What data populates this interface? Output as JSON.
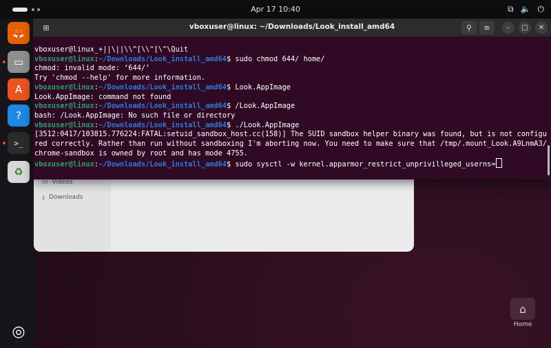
{
  "topbar": {
    "clock": "Apr 17  10:40",
    "tray_icons": [
      "network-icon",
      "volume-icon",
      "power-icon"
    ]
  },
  "dock": {
    "items": [
      {
        "name": "firefox-icon",
        "glyph": "🦊",
        "bg": "#e66000",
        "running": false
      },
      {
        "name": "files-icon",
        "glyph": "▭",
        "bg": "#8f8f8f",
        "running": true
      },
      {
        "name": "app-center-icon",
        "glyph": "A",
        "bg": "#e95420",
        "running": false
      },
      {
        "name": "help-icon",
        "glyph": "?",
        "bg": "#1e88e5",
        "running": false
      },
      {
        "name": "terminal-icon",
        "glyph": ">_",
        "bg": "#2b2b2b",
        "running": true
      },
      {
        "name": "trash-icon",
        "glyph": "♻",
        "bg": "#d8d8d8",
        "running": false
      }
    ],
    "show_apps_glyph": "◎"
  },
  "files_window": {
    "items": [
      "Videos",
      "Downloads"
    ]
  },
  "terminal": {
    "title": "vboxuser@linux: ~/Downloads/Look_install_amd64",
    "prompt_user": "vboxuser@linux",
    "prompt_sep": ":",
    "prompt_path": "~/Downloads/Look_install_amd64",
    "prompt_end": "$ ",
    "lines": [
      {
        "type": "out",
        "text": "vboxuser@linux_+||\\||\\\\^[\\\\^[\\^\\Quit"
      },
      {
        "type": "cmd",
        "text": "sudo chmod 644/ home/"
      },
      {
        "type": "out",
        "text": "chmod: invalid mode: ‘644/’"
      },
      {
        "type": "out",
        "text": "Try 'chmod --help' for more information."
      },
      {
        "type": "cmd",
        "text": "Look.AppImage"
      },
      {
        "type": "out",
        "text": "Look.AppImage: command not found"
      },
      {
        "type": "cmd",
        "text": "/Look.AppImage"
      },
      {
        "type": "out",
        "text": "bash: /Look.AppImage: No such file or directory"
      },
      {
        "type": "cmd",
        "text": "./Look.AppImage"
      },
      {
        "type": "out",
        "text": "[3512:0417/103815.776224:FATAL:setuid_sandbox_host.cc(158)] The SUID sandbox helper binary was found, but is not configu"
      },
      {
        "type": "out",
        "text": "red correctly. Rather than run without sandboxing I'm aborting now. You need to make sure that /tmp/.mount_Look.A9LnmA3/"
      },
      {
        "type": "out",
        "text": "chrome-sandbox is owned by root and has mode 4755."
      },
      {
        "type": "cmd",
        "text": "sudo sysctl -w kernel.apparmor_restrict_unprivilleged_userns=",
        "cursor": true
      }
    ]
  },
  "desktop": {
    "home_label": "Home"
  }
}
